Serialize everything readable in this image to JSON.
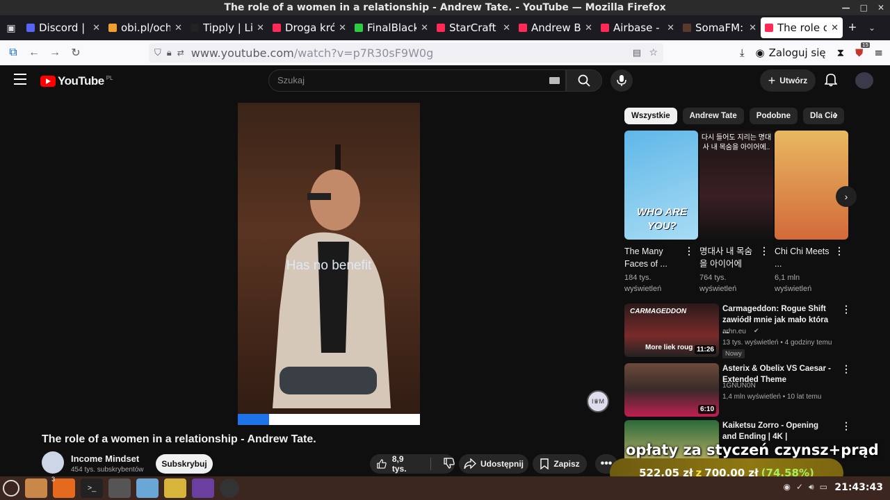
{
  "window": {
    "title": "The role of a women in a relationship - Andrew Tate. - YouTube — Mozilla Firefox"
  },
  "tabs": [
    {
      "label": "Discord | #",
      "color": "#5865f2"
    },
    {
      "label": "obi.pl/ochr",
      "color": "#f0a030"
    },
    {
      "label": "Tipply | Lis",
      "color": "#222222"
    },
    {
      "label": "Droga król",
      "color": "#ff2a55"
    },
    {
      "label": "FinalBlackp",
      "color": "#2ecc40"
    },
    {
      "label": "StarCraft -",
      "color": "#ff2a55"
    },
    {
      "label": "Andrew Be",
      "color": "#ff2a55"
    },
    {
      "label": "Airbase - M",
      "color": "#ff2a55"
    },
    {
      "label": "SomaFM: T",
      "color": "#5a3a2a"
    },
    {
      "label": "The role of",
      "color": "#ff2a55",
      "active": true
    }
  ],
  "navbar": {
    "url_host": "www.youtube.com",
    "url_path": "/watch?v=p7R30sF9W0g",
    "login_label": "Zaloguj się",
    "ext_badge": "15"
  },
  "youtube": {
    "logo_text": "YouTube",
    "country_code": "PL",
    "search_placeholder": "Szukaj",
    "create_label": "Utwórz",
    "subtitle": "Has no benefit",
    "progress_fraction": 0.17,
    "video_title": "The role of a women in a relationship - Andrew Tate.",
    "channel_name": "Income Mindset",
    "channel_subs": "454 tys. subskrybentów",
    "subscribe_label": "Subskrybuj",
    "like_count": "8,9 tys.",
    "share_label": "Udostępnij",
    "save_label": "Zapisz",
    "chips": [
      "Wszystkie",
      "Andrew Tate",
      "Podobne",
      "Dla Cie"
    ],
    "shorts": [
      {
        "title": "The Many Faces of ...",
        "views": "184 tys. wyświetleń",
        "thumb_text": "WHO ARE YOU?"
      },
      {
        "title": "명대사 내 목숨을 아이어에",
        "views": "764 tys. wyświetleń",
        "thumb_text": "다시 들어도 지리는 명대사 내 목숨을 아이어에.."
      },
      {
        "title": "Chi Chi Meets ...",
        "views": "6,1 mln wyświetleń",
        "thumb_text": ""
      }
    ],
    "videos": [
      {
        "title": "Carmageddon: Rogue Shift zawiódł mnie jak mało która ...",
        "channel": "arhn.eu",
        "meta": "13 tys. wyświetleń • 4 godziny temu",
        "duration": "11:26",
        "badge": "Nowy",
        "thumb_caption": "More liek roug",
        "thumb_logo": "CARMAGEDDON"
      },
      {
        "title": "Asterix & Obelix VS Caesar - Extended Theme",
        "channel": "1GNUN0N",
        "meta": "1,4 mln wyświetleń • 10 lat temu",
        "duration": "6:10"
      },
      {
        "title": "Kaiketsu Zorro - Opening and Ending | 4K |",
        "channel": "",
        "meta": "",
        "duration": ""
      }
    ]
  },
  "overlay": {
    "text": "opłaty za styczeń czynsz+prąd",
    "donation_current": "522,05 zł",
    "donation_sep": "z",
    "donation_goal": "700,00 zł",
    "donation_pct": "(74.58%)"
  },
  "taskbar": {
    "clock": "21:43:43",
    "firefox_badge": "3"
  }
}
